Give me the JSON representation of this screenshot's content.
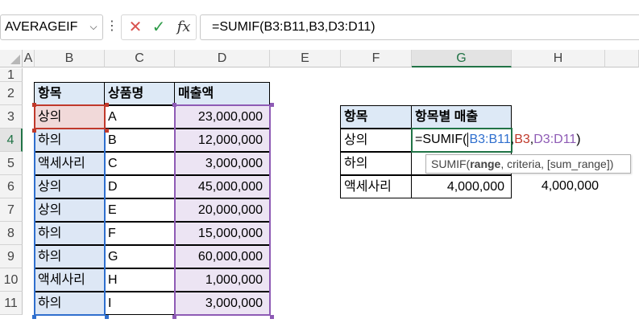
{
  "formula_bar": {
    "name_box": "AVERAGEIF",
    "dots": "⋮",
    "cancel_glyph": "✕",
    "enter_glyph": "✓",
    "fx_label": "fx",
    "formula": "=SUMIF(B3:B11,B3,D3:D11)"
  },
  "columns": [
    "A",
    "B",
    "C",
    "D",
    "E",
    "F",
    "G",
    "H"
  ],
  "rows": [
    "1",
    "2",
    "3",
    "4",
    "5",
    "6",
    "7",
    "8",
    "9",
    "10",
    "11"
  ],
  "table1": {
    "headers": [
      "항목",
      "상품명",
      "매출액"
    ],
    "rows": [
      [
        "상의",
        "A",
        "23,000,000"
      ],
      [
        "하의",
        "B",
        "12,000,000"
      ],
      [
        "액세사리",
        "C",
        "3,000,000"
      ],
      [
        "상의",
        "D",
        "45,000,000"
      ],
      [
        "상의",
        "E",
        "20,000,000"
      ],
      [
        "하의",
        "F",
        "15,000,000"
      ],
      [
        "하의",
        "G",
        "60,000,000"
      ],
      [
        "액세사리",
        "H",
        "1,000,000"
      ],
      [
        "하의",
        "I",
        "3,000,000"
      ]
    ]
  },
  "table2": {
    "headers": [
      "항목",
      "항목별 매출"
    ],
    "rows": [
      [
        "상의",
        ""
      ],
      [
        "하의",
        ""
      ],
      [
        "액세사리",
        "4,000,000"
      ]
    ]
  },
  "h6_value": "4,000,000",
  "edit": {
    "prefix": "=SUMIF(",
    "arg1": "B3:B11",
    "sep1": ",",
    "arg2": "B3",
    "sep2": ",",
    "arg3": "D3:D11",
    "suffix": ")"
  },
  "tooltip": {
    "fn": "SUMIF(",
    "bold_arg": "range",
    "rest": ", criteria, [sum_range])"
  },
  "colors": {
    "ref_blue": "#2f6fce",
    "ref_red": "#c0392b",
    "ref_purple": "#8e5bb5",
    "blue_fill": "#dde7f5",
    "purple_fill": "#ece4f3",
    "red_fill": "#f1d9d9",
    "header_fill": "#dde9f6",
    "accent": "#217346"
  }
}
